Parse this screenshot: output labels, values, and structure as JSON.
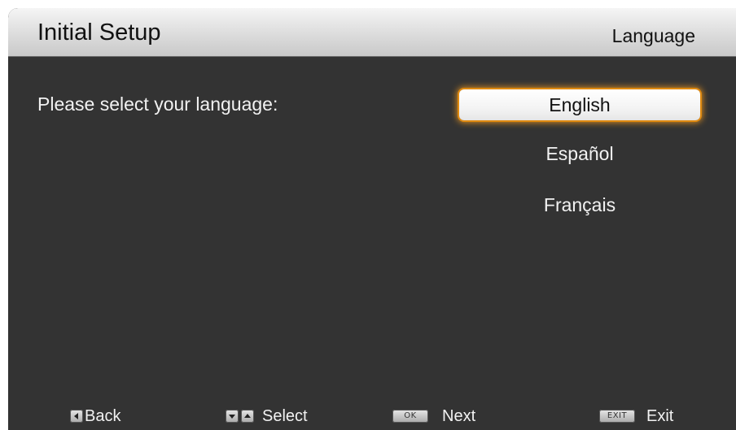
{
  "header": {
    "title": "Initial Setup",
    "section": "Language"
  },
  "main": {
    "prompt": "Please select your language:",
    "languages": [
      {
        "label": "English",
        "selected": true
      },
      {
        "label": "Español",
        "selected": false
      },
      {
        "label": "Français",
        "selected": false
      }
    ]
  },
  "footer": {
    "back_label": "Back",
    "select_label": "Select",
    "ok_key": "OK",
    "next_label": "Next",
    "exit_key": "EXIT",
    "exit_label": "Exit"
  },
  "colors": {
    "background": "#333333",
    "header": "#dcdcdc",
    "selection_glow": "#e08a10"
  },
  "icons": [
    "left-arrow-key-icon",
    "down-arrow-key-icon",
    "up-arrow-key-icon",
    "ok-key-icon",
    "exit-key-icon"
  ]
}
